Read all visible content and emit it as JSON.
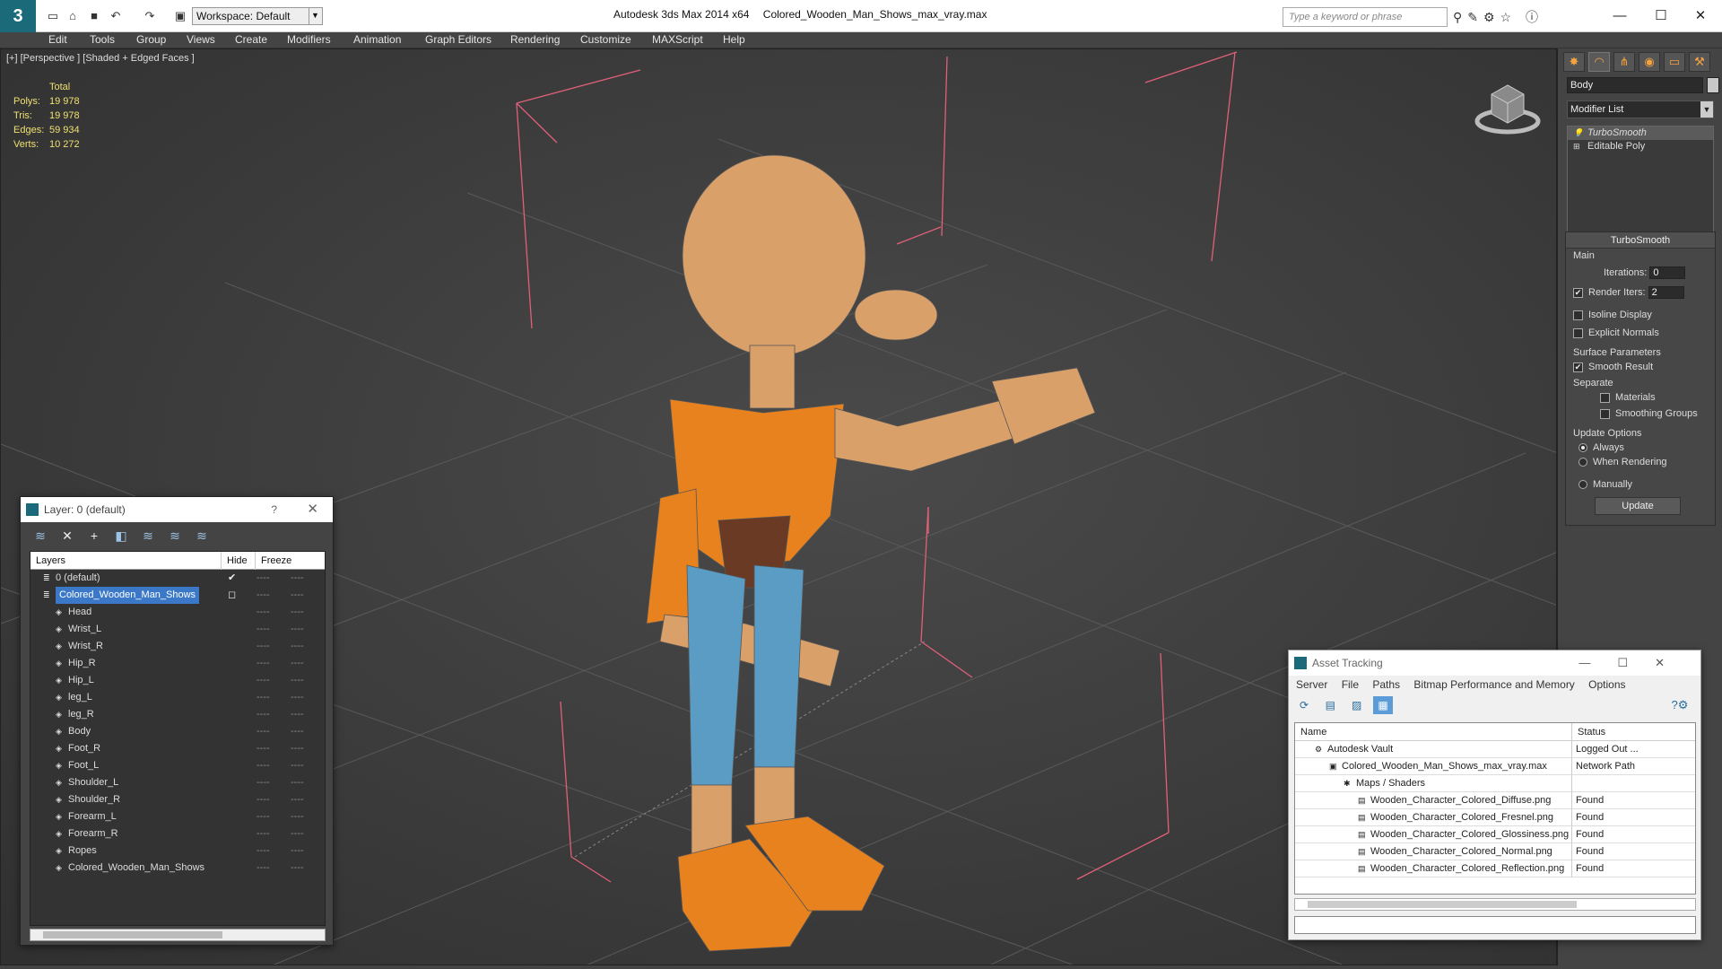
{
  "titlebar": {
    "workspace": "Workspace: Default",
    "app": "Autodesk 3ds Max  2014 x64",
    "file": "Colored_Wooden_Man_Shows_max_vray.max",
    "search_placeholder": "Type a keyword or phrase"
  },
  "menu": [
    "Edit",
    "Tools",
    "Group",
    "Views",
    "Create",
    "Modifiers",
    "Animation",
    "Graph Editors",
    "Rendering",
    "Customize",
    "MAXScript",
    "Help"
  ],
  "viewport": {
    "label": "[+] [Perspective ] [Shaded + Edged Faces ]",
    "stats": {
      "header": "Total",
      "rows": [
        {
          "k": "Polys:",
          "v": "19 978"
        },
        {
          "k": "Tris:",
          "v": "19 978"
        },
        {
          "k": "Edges:",
          "v": "59 934"
        },
        {
          "k": "Verts:",
          "v": "10 272"
        }
      ]
    }
  },
  "command_panel": {
    "object_name": "Body",
    "modifier_list": "Modifier List",
    "stack": [
      "TurboSmooth",
      "Editable Poly"
    ],
    "rollout_title": "TurboSmooth",
    "main": {
      "group": "Main",
      "iterations_label": "Iterations:",
      "iterations_value": "0",
      "render_iters_label": "Render Iters:",
      "render_iters_value": "2",
      "isoline": "Isoline Display",
      "explicit": "Explicit Normals"
    },
    "surface": {
      "group": "Surface Parameters",
      "smooth_result": "Smooth Result",
      "separate": "Separate",
      "materials": "Materials",
      "smoothing_groups": "Smoothing Groups"
    },
    "update": {
      "group": "Update Options",
      "always": "Always",
      "when_rendering": "When Rendering",
      "manually": "Manually",
      "button": "Update"
    }
  },
  "layer_window": {
    "title": "Layer: 0 (default)",
    "help": "?",
    "columns": {
      "layers": "Layers",
      "hide": "Hide",
      "freeze": "Freeze"
    },
    "rows": [
      {
        "name": "0 (default)",
        "level": 0,
        "mark": "✔"
      },
      {
        "name": "Colored_Wooden_Man_Shows",
        "level": 0,
        "selected": true,
        "mark": "◻"
      },
      {
        "name": "Head",
        "level": 1
      },
      {
        "name": "Wrist_L",
        "level": 1
      },
      {
        "name": "Wrist_R",
        "level": 1
      },
      {
        "name": "Hip_R",
        "level": 1
      },
      {
        "name": "Hip_L",
        "level": 1
      },
      {
        "name": "leg_L",
        "level": 1
      },
      {
        "name": "leg_R",
        "level": 1
      },
      {
        "name": "Body",
        "level": 1
      },
      {
        "name": "Foot_R",
        "level": 1
      },
      {
        "name": "Foot_L",
        "level": 1
      },
      {
        "name": "Shoulder_L",
        "level": 1
      },
      {
        "name": "Shoulder_R",
        "level": 1
      },
      {
        "name": "Forearm_L",
        "level": 1
      },
      {
        "name": "Forearm_R",
        "level": 1
      },
      {
        "name": "Ropes",
        "level": 1
      },
      {
        "name": "Colored_Wooden_Man_Shows",
        "level": 1
      }
    ],
    "dash": "----"
  },
  "asset_window": {
    "title": "Asset Tracking",
    "menu": [
      "Server",
      "File",
      "Paths",
      "Bitmap Performance and Memory",
      "Options"
    ],
    "columns": {
      "name": "Name",
      "status": "Status"
    },
    "rows": [
      {
        "name": "Autodesk Vault",
        "status": "Logged Out ...",
        "level": 1
      },
      {
        "name": "Colored_Wooden_Man_Shows_max_vray.max",
        "status": "Network Path",
        "level": 2
      },
      {
        "name": "Maps / Shaders",
        "status": "",
        "level": 3
      },
      {
        "name": "Wooden_Character_Colored_Diffuse.png",
        "status": "Found",
        "level": 4
      },
      {
        "name": "Wooden_Character_Colored_Fresnel.png",
        "status": "Found",
        "level": 4
      },
      {
        "name": "Wooden_Character_Colored_Glossiness.png",
        "status": "Found",
        "level": 4
      },
      {
        "name": "Wooden_Character_Colored_Normal.png",
        "status": "Found",
        "level": 4
      },
      {
        "name": "Wooden_Character_Colored_Reflection.png",
        "status": "Found",
        "level": 4
      }
    ]
  },
  "colors": {
    "wood": "#d9a06a",
    "orange": "#e8821e",
    "blue": "#5a9cc4",
    "brown": "#6a3a24",
    "bbox": "#e0607a"
  }
}
